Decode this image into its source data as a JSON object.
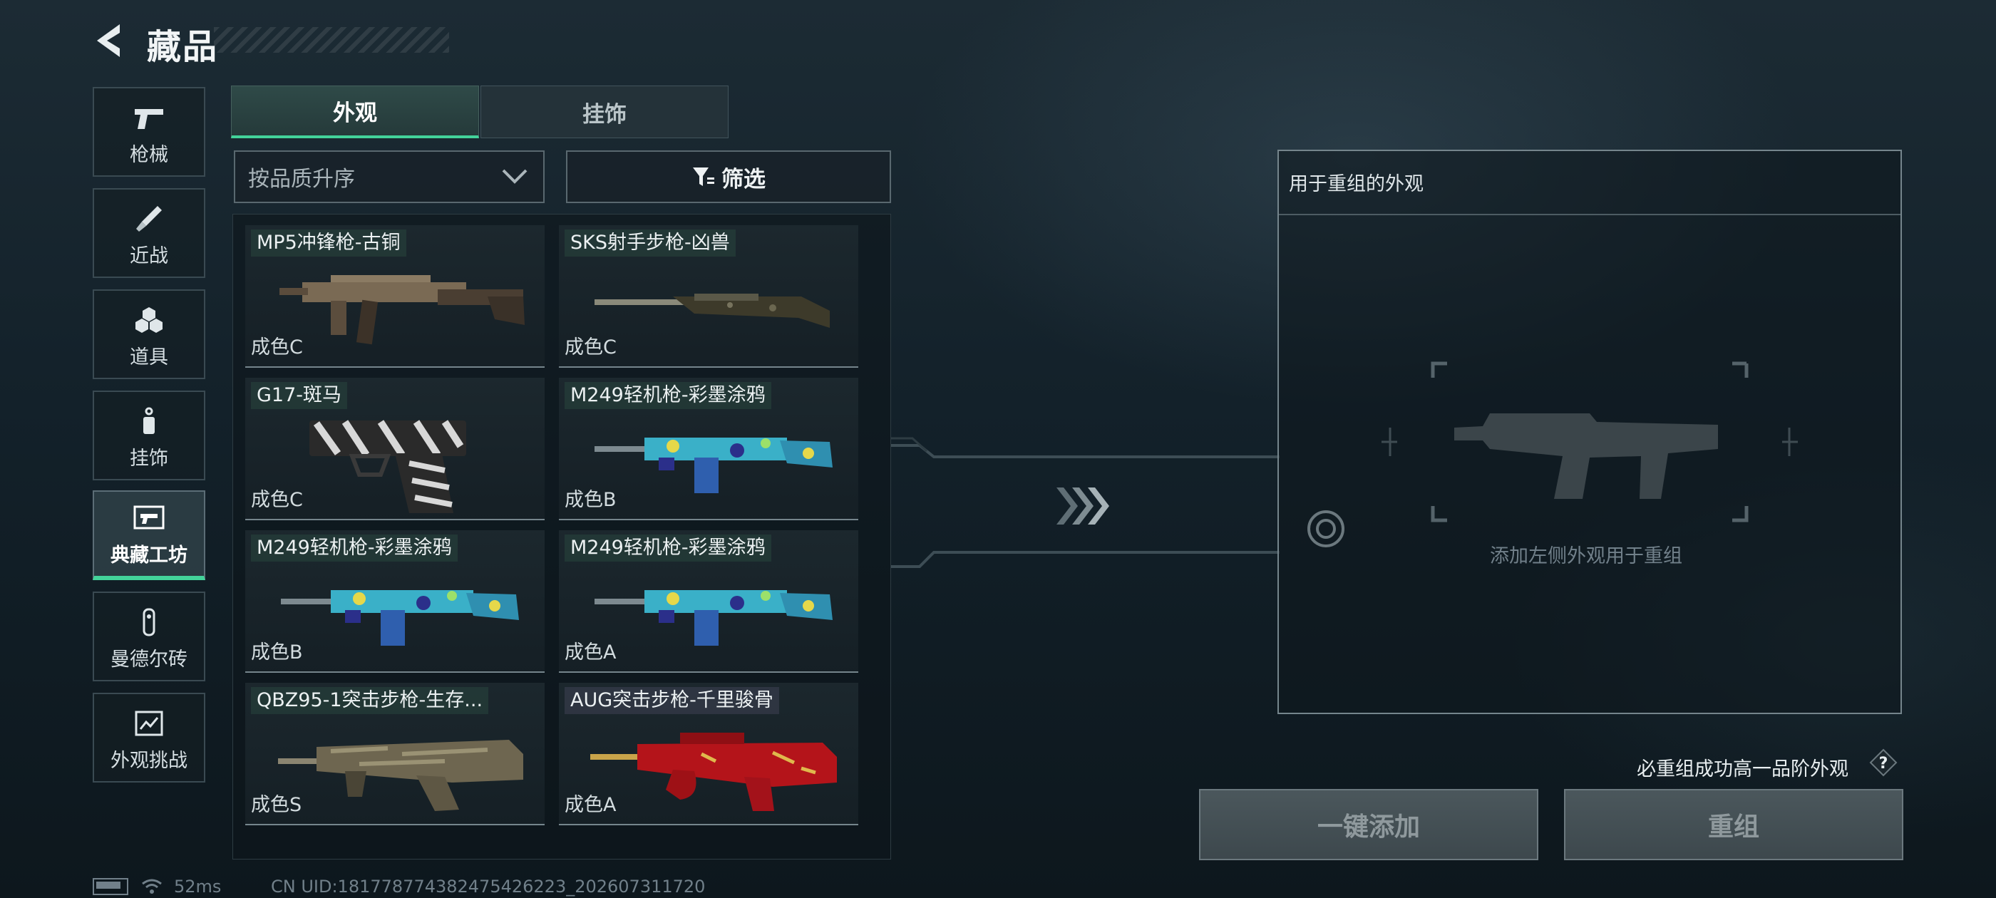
{
  "header": {
    "title": "藏品"
  },
  "sidebar": {
    "items": [
      {
        "label": "枪械",
        "icon": "pistol-icon",
        "active": false
      },
      {
        "label": "近战",
        "icon": "knife-icon",
        "active": false
      },
      {
        "label": "道具",
        "icon": "grenade-icon",
        "active": false
      },
      {
        "label": "挂饰",
        "icon": "charm-icon",
        "active": false
      },
      {
        "label": "典藏工坊",
        "icon": "workshop-icon",
        "active": true
      },
      {
        "label": "曼德尔砖",
        "icon": "mandel-brick-icon",
        "active": false
      },
      {
        "label": "外观挑战",
        "icon": "challenge-icon",
        "active": false
      }
    ]
  },
  "tabs": [
    {
      "label": "外观",
      "active": true
    },
    {
      "label": "挂饰",
      "active": false
    }
  ],
  "sort": {
    "label": "按品质升序"
  },
  "filter": {
    "label": "筛选"
  },
  "items": [
    {
      "name": "MP5冲锋枪-古铜",
      "grade": "成色C",
      "weapon": "smg",
      "skin": "bronze"
    },
    {
      "name": "SKS射手步枪-凶兽",
      "grade": "成色C",
      "weapon": "rifle",
      "skin": "camo"
    },
    {
      "name": "G17-斑马",
      "grade": "成色C",
      "weapon": "pistol",
      "skin": "zebra"
    },
    {
      "name": "M249轻机枪-彩墨涂鸦",
      "grade": "成色B",
      "weapon": "lmg",
      "skin": "graffiti"
    },
    {
      "name": "M249轻机枪-彩墨涂鸦",
      "grade": "成色B",
      "weapon": "lmg",
      "skin": "graffiti"
    },
    {
      "name": "M249轻机枪-彩墨涂鸦",
      "grade": "成色A",
      "weapon": "lmg",
      "skin": "graffiti"
    },
    {
      "name": "QBZ95-1突击步枪-生存...",
      "grade": "成色S",
      "weapon": "bullpup",
      "skin": "survival"
    },
    {
      "name": "AUG突击步枪-千里骏骨",
      "grade": "成色A",
      "weapon": "aug",
      "skin": "red-gold"
    }
  ],
  "panel": {
    "title": "用于重组的外观",
    "hint": "添加左侧外观用于重组"
  },
  "note": "必重组成功高一品阶外观",
  "buttons": {
    "add": "一键添加",
    "recombine": "重组"
  },
  "status": {
    "ping": "52ms",
    "uid": "CN UID:1817787743824754262​23_202607311720"
  },
  "colors": {
    "accent": "#43d39a",
    "panel_border": "#75858c"
  }
}
